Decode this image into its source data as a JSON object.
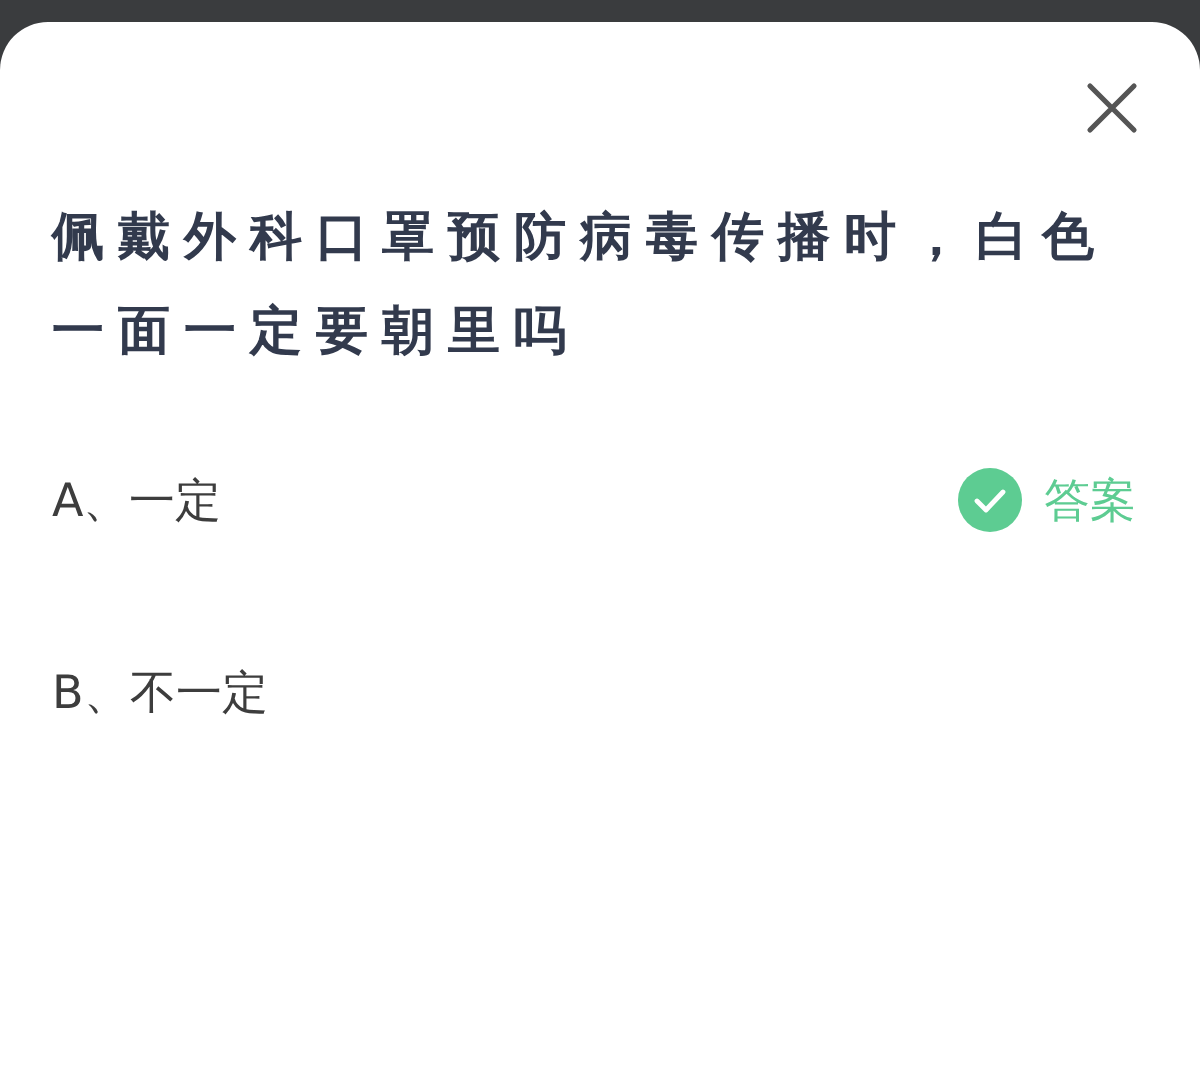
{
  "question": "佩戴外科口罩预防病毒传播时，白色一面一定要朝里吗",
  "options": [
    {
      "label": "A、一定",
      "correct": true,
      "answer_label": "答案"
    },
    {
      "label": "B、不一定",
      "correct": false
    }
  ]
}
